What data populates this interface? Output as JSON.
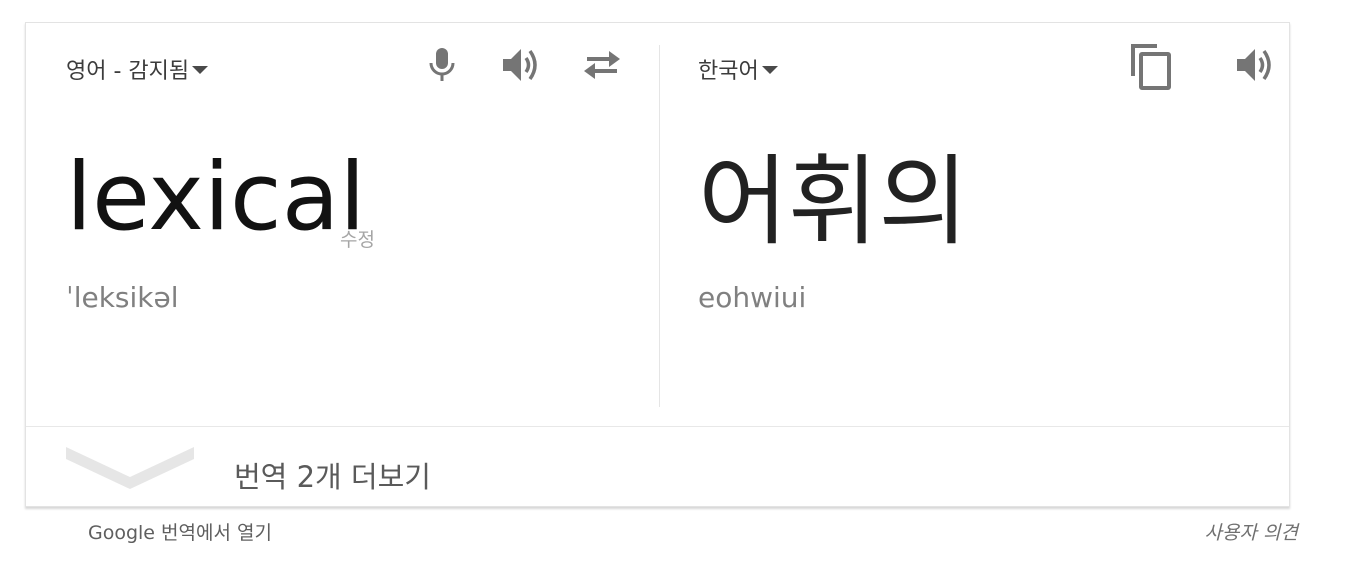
{
  "source": {
    "language_label": "영어 - 감지됨",
    "text": "lexical",
    "edit_label": "수정",
    "phonetic": "ˈleksikəl",
    "icons": [
      "microphone-icon",
      "speaker-icon",
      "swap-languages-icon"
    ]
  },
  "target": {
    "language_label": "한국어",
    "text": "어휘의",
    "romanization": "eohwiui",
    "icons": [
      "copy-icon",
      "speaker-icon"
    ]
  },
  "more_translations": {
    "label": "번역 2개 더보기",
    "icon": "chevron-down-icon"
  },
  "footer": {
    "open_in_translate": "Google 번역에서 열기",
    "feedback": "사용자 의견"
  },
  "colors": {
    "icon_gray": "#757575",
    "text_dark": "#121212",
    "text_muted": "#808080",
    "chevron_light": "#e6e6e6"
  }
}
